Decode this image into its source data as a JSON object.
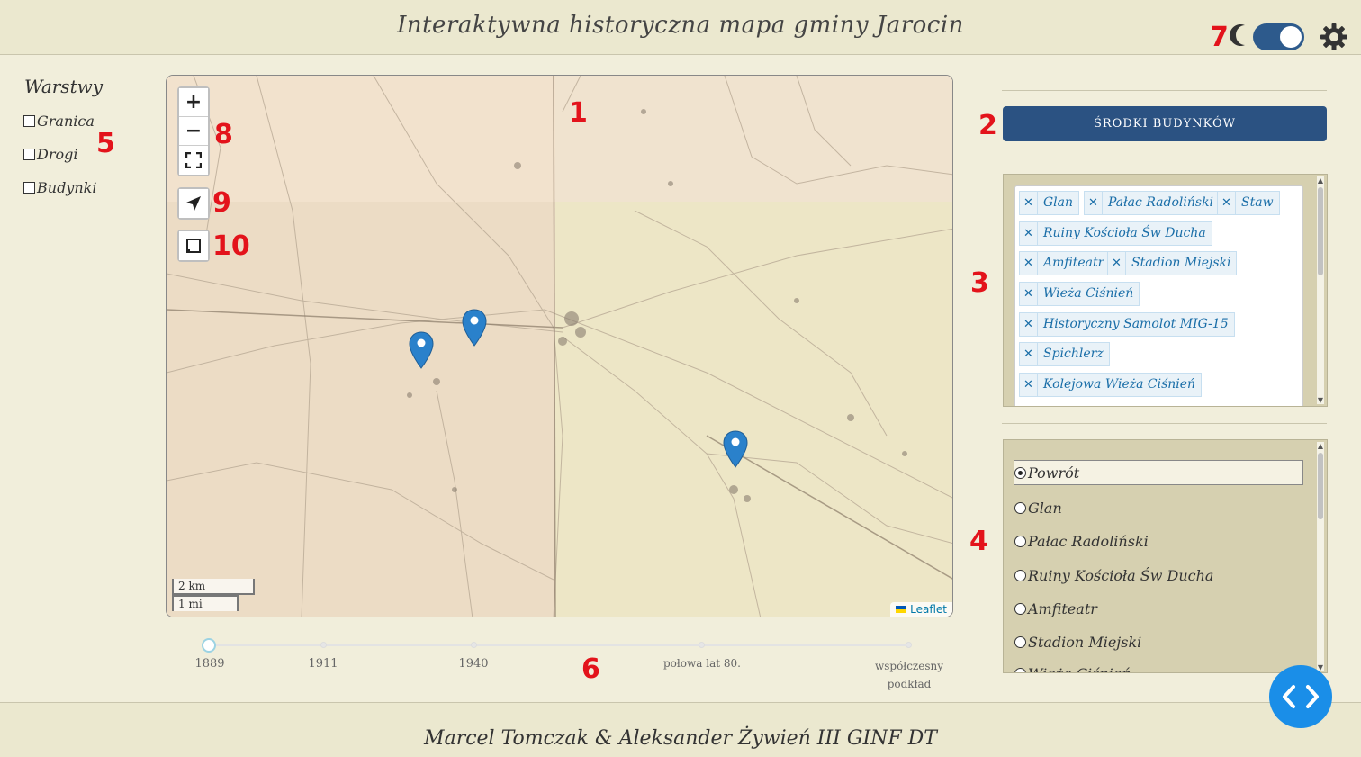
{
  "header": {
    "title": "Interaktywna historyczna mapa gminy Jarocin"
  },
  "theme": {
    "accent": "#2b5282",
    "annotation_color": "#e3131b",
    "dark_mode_toggle": "on",
    "moon_icon": "moon-icon",
    "settings_icon": "gear-icon"
  },
  "annotations": [
    "1",
    "2",
    "3",
    "4",
    "5",
    "6",
    "7",
    "8",
    "9",
    "10"
  ],
  "layers": {
    "title": "Warstwy",
    "items": [
      {
        "label": "Granica",
        "checked": false
      },
      {
        "label": "Drogi",
        "checked": false
      },
      {
        "label": "Budynki",
        "checked": false
      }
    ]
  },
  "map": {
    "controls": {
      "zoom_in": "+",
      "zoom_out": "−",
      "fullscreen": "fullscreen-icon",
      "locate": "locate-arrow-icon",
      "draw": "draw-rectangle-icon"
    },
    "scale": {
      "km": "2 km",
      "mi": "1 mi"
    },
    "attribution": "Leaflet",
    "markers": 3
  },
  "timeline": {
    "ticks": [
      "1889",
      "1911",
      "1940",
      "połowa lat 80.",
      "współczesny podkład"
    ],
    "selected": "1889"
  },
  "right": {
    "button": "ŚRODKI BUDYNKÓW",
    "tags": [
      "Glan",
      "Pałac Radoliński",
      "Staw",
      "Ruiny Kościoła Św Ducha",
      "Amfiteatr",
      "Stadion Miejski",
      "Wieża Ciśnień",
      "Historyczny Samolot MIG-15",
      "Spichlerz",
      "Kolejowa Wieża Ciśnień"
    ],
    "radios": [
      {
        "label": "Powrót",
        "selected": true
      },
      {
        "label": "Glan",
        "selected": false
      },
      {
        "label": "Pałac Radoliński",
        "selected": false
      },
      {
        "label": "Ruiny Kościoła Św Ducha",
        "selected": false
      },
      {
        "label": "Amfiteatr",
        "selected": false
      },
      {
        "label": "Stadion Miejski",
        "selected": false
      },
      {
        "label": "Wieża Ciśnień",
        "selected": false
      }
    ]
  },
  "footer": {
    "text": "Marcel Tomczak & Aleksander Żywień III GINF DT"
  },
  "code_button": "code-icon"
}
